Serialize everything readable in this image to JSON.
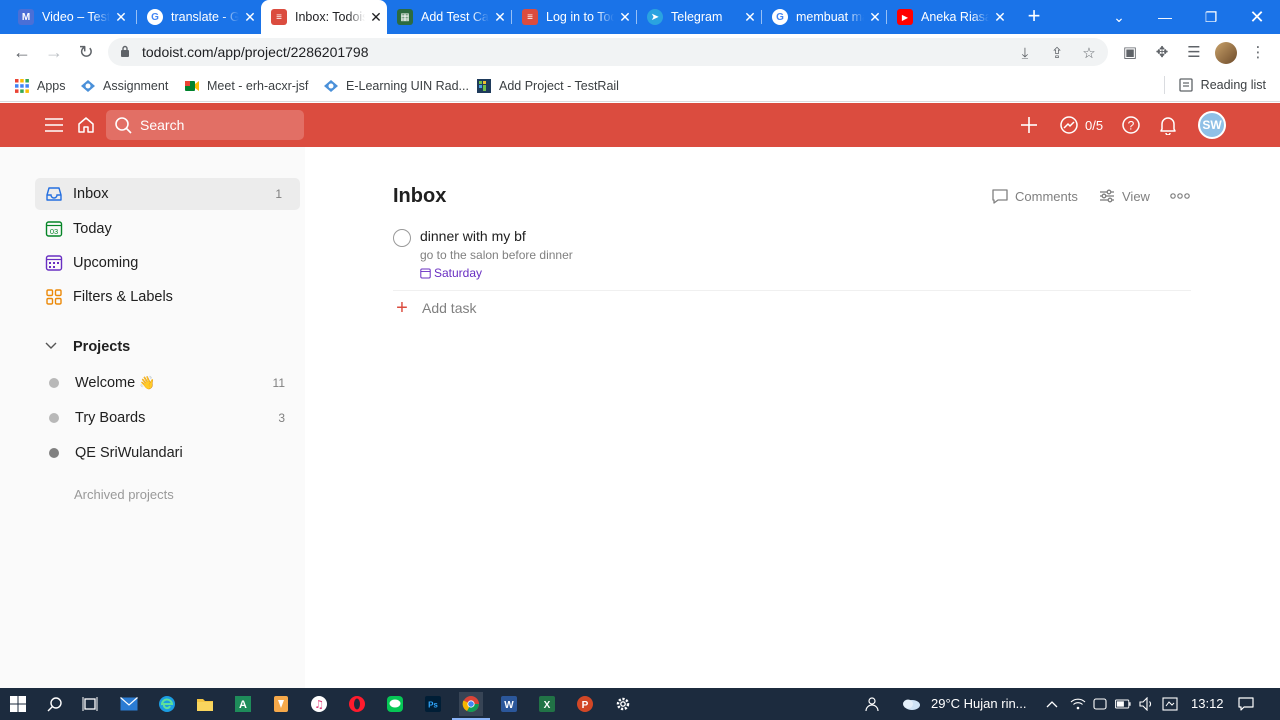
{
  "browser": {
    "tabs": [
      {
        "title": "Video – Test",
        "favicon": "gmail-icon",
        "color": "#4a6fd6",
        "active": false
      },
      {
        "title": "translate - Google",
        "favicon": "google-icon",
        "color": "#ffffff",
        "active": false
      },
      {
        "title": "Inbox: Todoist",
        "favicon": "todoist-icon",
        "color": "#db4c3f",
        "active": true
      },
      {
        "title": "Add Test Case",
        "favicon": "testrail-icon",
        "color": "#2c8a3f",
        "active": false
      },
      {
        "title": "Log in to Todoist",
        "favicon": "todoist-icon",
        "color": "#db4c3f",
        "active": false
      },
      {
        "title": "Telegram",
        "favicon": "telegram-icon",
        "color": "#2aa3e0",
        "active": false
      },
      {
        "title": "membuat makalah",
        "favicon": "google-icon",
        "color": "#ffffff",
        "active": false
      },
      {
        "title": "Aneka Riasan",
        "favicon": "youtube-icon",
        "color": "#ff0000",
        "active": false
      }
    ],
    "url": "todoist.com/app/project/2286201798",
    "bookmarks": [
      {
        "label": "Apps",
        "icon": "apps-grid-icon"
      },
      {
        "label": "Assignment",
        "icon": "google-classroom-icon"
      },
      {
        "label": "Meet - erh-acxr-jsf",
        "icon": "google-meet-icon"
      },
      {
        "label": "E-Learning UIN Rad...",
        "icon": "elearning-icon"
      },
      {
        "label": "Add Project - TestRail",
        "icon": "testrail-icon"
      }
    ],
    "reading_list": "Reading list"
  },
  "app": {
    "search_label": "Search",
    "karma": "0/5",
    "avatar_initials": "SW",
    "brand_color": "#db4c3f"
  },
  "sidebar": {
    "nav": [
      {
        "label": "Inbox",
        "count": "1",
        "icon": "inbox-icon",
        "color": "#246fe0"
      },
      {
        "label": "Today",
        "count": "",
        "icon": "calendar-today-icon",
        "icon_text": "03",
        "color": "#058527"
      },
      {
        "label": "Upcoming",
        "count": "",
        "icon": "calendar-upcoming-icon",
        "color": "#692fc2"
      },
      {
        "label": "Filters & Labels",
        "count": "",
        "icon": "filters-labels-icon",
        "color": "#eb8909"
      }
    ],
    "projects_header": "Projects",
    "projects": [
      {
        "label": "Welcome",
        "emoji": "👋",
        "count": "11",
        "color": "#b8b8b8"
      },
      {
        "label": "Try Boards",
        "emoji": "",
        "count": "3",
        "color": "#b8b8b8"
      },
      {
        "label": "QE SriWulandari",
        "emoji": "",
        "count": "",
        "color": "#808080"
      }
    ],
    "archived": "Archived projects"
  },
  "main": {
    "title": "Inbox",
    "actions": {
      "comments": "Comments",
      "view": "View"
    },
    "tasks": [
      {
        "name": "dinner with my bf",
        "description": "go to the salon before dinner",
        "due": "Saturday"
      }
    ],
    "add_task": "Add task"
  },
  "taskbar": {
    "weather": "29°C  Hujan rin...",
    "time": "13:12"
  }
}
